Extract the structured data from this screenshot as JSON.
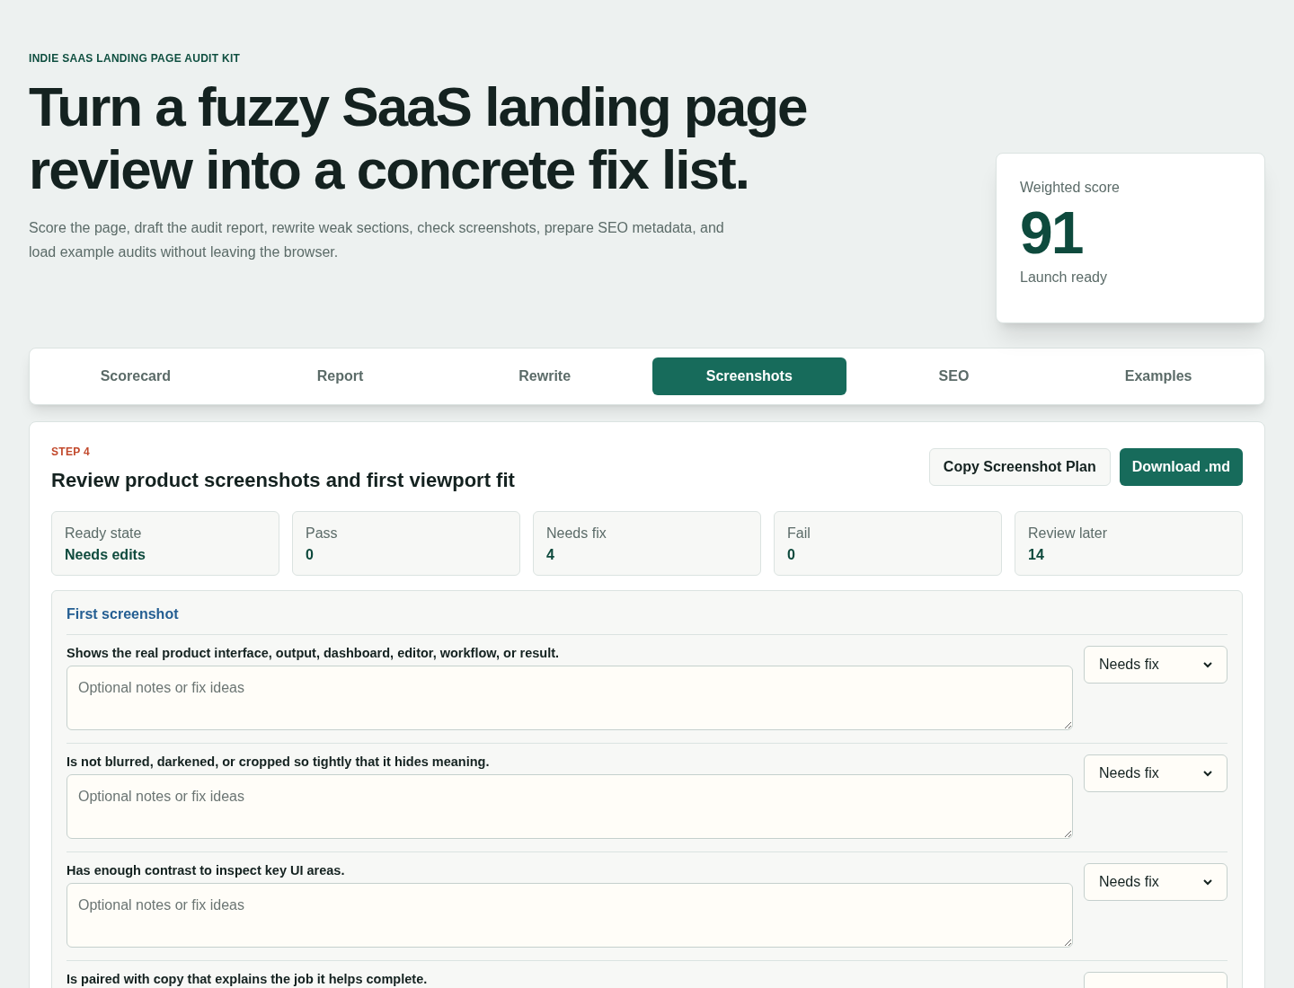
{
  "eyebrow": "INDIE SAAS LANDING PAGE AUDIT KIT",
  "title": "Turn a fuzzy SaaS landing page review into a concrete fix list.",
  "intro": "Score the page, draft the audit report, rewrite weak sections, check screenshots, prepare SEO metadata, and load example audits without leaving the browser.",
  "score_card": {
    "label": "Weighted score",
    "value": "91",
    "status": "Launch ready"
  },
  "tabs": [
    {
      "label": "Scorecard",
      "selected": false
    },
    {
      "label": "Report",
      "selected": false
    },
    {
      "label": "Rewrite",
      "selected": false
    },
    {
      "label": "Screenshots",
      "selected": true
    },
    {
      "label": "SEO",
      "selected": false
    },
    {
      "label": "Examples",
      "selected": false
    }
  ],
  "panel": {
    "step": "STEP 4",
    "heading": "Review product screenshots and first viewport fit",
    "buttons": [
      {
        "label": "Copy Screenshot Plan",
        "kind": "secondary"
      },
      {
        "label": "Download .md",
        "kind": "primary"
      }
    ],
    "stats": [
      {
        "label": "Ready state",
        "value": "Needs edits"
      },
      {
        "label": "Pass",
        "value": "0"
      },
      {
        "label": "Needs fix",
        "value": "4"
      },
      {
        "label": "Fail",
        "value": "0"
      },
      {
        "label": "Review later",
        "value": "14"
      }
    ],
    "section": {
      "title": "First screenshot",
      "items": [
        {
          "label": "Shows the real product interface, output, dashboard, editor, workflow, or result.",
          "placeholder": "Optional notes or fix ideas",
          "status": "Needs fix"
        },
        {
          "label": "Is not blurred, darkened, or cropped so tightly that it hides meaning.",
          "placeholder": "Optional notes or fix ideas",
          "status": "Needs fix"
        },
        {
          "label": "Has enough contrast to inspect key UI areas.",
          "placeholder": "Optional notes or fix ideas",
          "status": "Needs fix"
        },
        {
          "label": "Is paired with copy that explains the job it helps complete."
        }
      ]
    }
  }
}
